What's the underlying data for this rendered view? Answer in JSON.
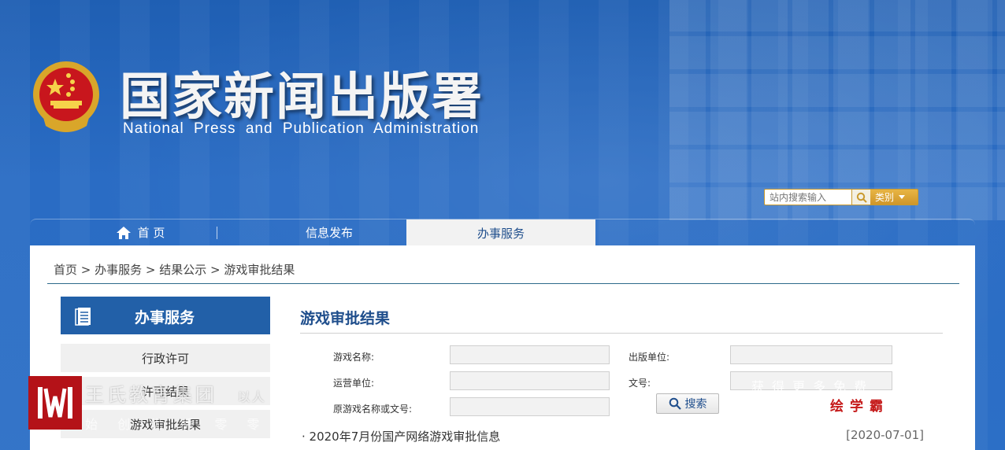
{
  "header": {
    "title": "国家新闻出版署",
    "subtitle": "National Press and Publication Administration",
    "search_placeholder": "站内搜索输入",
    "category_label": "类别"
  },
  "nav": {
    "home": "首 页",
    "info": "信息发布",
    "service": "办事服务"
  },
  "breadcrumb": "首页 > 办事服务 > 结果公示 > 游戏审批结果",
  "sidebar": {
    "heading": "办事服务",
    "items": [
      {
        "label": "行政许可"
      },
      {
        "label": "许可结果"
      },
      {
        "label": "游戏审批结果"
      }
    ]
  },
  "main": {
    "title": "游戏审批结果",
    "form": {
      "game_name_label": "游戏名称:",
      "publisher_label": "出版单位:",
      "operator_label": "运营单位:",
      "doc_no_label": "文号:",
      "orig_name_label": "原游戏名称或文号:",
      "search_button": "搜索"
    },
    "results": [
      {
        "title": "2020年7月份国产网络游戏审批信息",
        "date": "[2020-07-01]"
      }
    ]
  },
  "watermark": {
    "org": "王氏教育集团",
    "line2": "以人",
    "line3": "始 创 优 秀 零 零",
    "promo": "获得更多免费",
    "brand": "绘学霸"
  },
  "colors": {
    "header_blue": "#2a6cc4",
    "accent_blue": "#2260a8",
    "search_gold": "#cf962a",
    "watermark_red": "#b41218"
  }
}
